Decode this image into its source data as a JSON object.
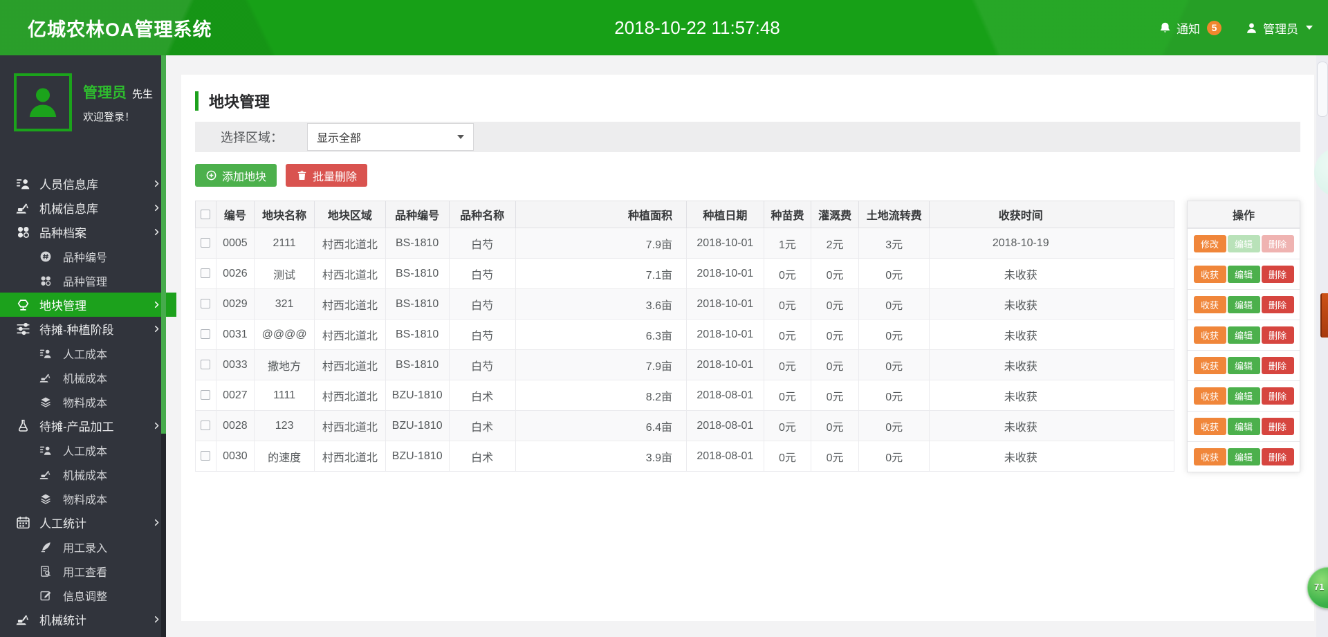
{
  "colors": {
    "brand_green": "#17a017",
    "accent_green": "#4cb04c",
    "active_menu_green": "#1ca11c",
    "danger_red": "#d9534f",
    "action_orange": "#f0863a",
    "badge_orange": "#f0872e",
    "sidebar_bg": "#31343c"
  },
  "header": {
    "app_title": "亿城农林OA管理系统",
    "datetime": "2018-10-22 11:57:48",
    "notifications": {
      "label": "通知",
      "count": "5"
    },
    "user_menu": {
      "label": "管理员"
    }
  },
  "sidebar": {
    "user": {
      "name": "管理员",
      "honorific": "先生",
      "welcome": "欢迎登录！"
    },
    "menu": [
      {
        "id": "personnel-info",
        "icon": "person",
        "label": "人员信息库",
        "arrow": true
      },
      {
        "id": "machinery-info",
        "icon": "crane",
        "label": "机械信息库",
        "arrow": true
      },
      {
        "id": "variety-archive",
        "icon": "clover",
        "label": "品种档案",
        "arrow": true,
        "children": [
          {
            "id": "variety-code",
            "icon": "hash",
            "label": "品种编号"
          },
          {
            "id": "variety-manage",
            "icon": "clover",
            "label": "品种管理"
          }
        ]
      },
      {
        "id": "plot-management",
        "icon": "plot",
        "label": "地块管理",
        "arrow": true,
        "active": true
      },
      {
        "id": "pending-planting-stage",
        "icon": "sliders",
        "label": "待摊-种植阶段",
        "arrow": true,
        "children": [
          {
            "id": "planting-labor-cost",
            "icon": "person",
            "label": "人工成本"
          },
          {
            "id": "planting-machine-cost",
            "icon": "crane",
            "label": "机械成本"
          },
          {
            "id": "planting-material-cost",
            "icon": "layers",
            "label": "物料成本"
          }
        ]
      },
      {
        "id": "pending-product-processing",
        "icon": "flask",
        "label": "待摊-产品加工",
        "arrow": true,
        "children": [
          {
            "id": "processing-labor-cost",
            "icon": "person",
            "label": "人工成本"
          },
          {
            "id": "processing-machine-cost",
            "icon": "crane",
            "label": "机械成本"
          },
          {
            "id": "processing-material-cost",
            "icon": "layers",
            "label": "物料成本"
          }
        ]
      },
      {
        "id": "labor-statistics",
        "icon": "calendar",
        "label": "人工统计",
        "arrow": true,
        "children": [
          {
            "id": "labor-entry",
            "icon": "pen",
            "label": "用工录入"
          },
          {
            "id": "labor-view",
            "icon": "doc-search",
            "label": "用工查看"
          },
          {
            "id": "info-adjust",
            "icon": "edit-square",
            "label": "信息调整"
          }
        ]
      },
      {
        "id": "machinery-statistics",
        "icon": "crane",
        "label": "机械统计",
        "arrow": true
      }
    ]
  },
  "main": {
    "page_title": "地块管理",
    "filter": {
      "label": "选择区域：",
      "selected_option": "显示全部"
    },
    "toolbar": {
      "add_plot": "添加地块",
      "batch_delete": "批量删除"
    },
    "table": {
      "action_header": "操作",
      "col_ids": [
        "id",
        "plot-name",
        "plot-region",
        "variety-code",
        "variety-name",
        "planting-area",
        "planting-date",
        "seedling-fee",
        "irrigation-fee",
        "land-transfer-fee",
        "harvest-time"
      ],
      "headers": [
        "编号",
        "地块名称",
        "地块区域",
        "品种编号",
        "品种名称",
        "种植面积",
        "种植日期",
        "种苗费",
        "灌溉费",
        "土地流转费",
        "收获时间"
      ],
      "rows": [
        {
          "cells": [
            "0005",
            "2111",
            "村西北道北",
            "BS-1810",
            "白芍",
            "7.9亩",
            "2018-10-01",
            "1元",
            "2元",
            "3元",
            "2018-10-19"
          ],
          "actions": [
            {
              "name": "modify-button",
              "label": "修改",
              "style": "orange",
              "disabled": false
            },
            {
              "name": "edit-button",
              "label": "编辑",
              "style": "green",
              "disabled": true
            },
            {
              "name": "delete-button",
              "label": "删除",
              "style": "red",
              "disabled": true
            }
          ]
        },
        {
          "cells": [
            "0026",
            "测试",
            "村西北道北",
            "BS-1810",
            "白芍",
            "7.1亩",
            "2018-10-01",
            "0元",
            "0元",
            "0元",
            "未收获"
          ],
          "actions": [
            {
              "name": "harvest-button",
              "label": "收获",
              "style": "orange",
              "disabled": false
            },
            {
              "name": "edit-button",
              "label": "编辑",
              "style": "green",
              "disabled": false
            },
            {
              "name": "delete-button",
              "label": "删除",
              "style": "red",
              "disabled": false
            }
          ]
        },
        {
          "cells": [
            "0029",
            "321",
            "村西北道北",
            "BS-1810",
            "白芍",
            "3.6亩",
            "2018-10-01",
            "0元",
            "0元",
            "0元",
            "未收获"
          ],
          "actions": [
            {
              "name": "harvest-button",
              "label": "收获",
              "style": "orange",
              "disabled": false
            },
            {
              "name": "edit-button",
              "label": "编辑",
              "style": "green",
              "disabled": false
            },
            {
              "name": "delete-button",
              "label": "删除",
              "style": "red",
              "disabled": false
            }
          ]
        },
        {
          "cells": [
            "0031",
            "@@@@",
            "村西北道北",
            "BS-1810",
            "白芍",
            "6.3亩",
            "2018-10-01",
            "0元",
            "0元",
            "0元",
            "未收获"
          ],
          "actions": [
            {
              "name": "harvest-button",
              "label": "收获",
              "style": "orange",
              "disabled": false
            },
            {
              "name": "edit-button",
              "label": "编辑",
              "style": "green",
              "disabled": false
            },
            {
              "name": "delete-button",
              "label": "删除",
              "style": "red",
              "disabled": false
            }
          ]
        },
        {
          "cells": [
            "0033",
            "撒地方",
            "村西北道北",
            "BS-1810",
            "白芍",
            "7.9亩",
            "2018-10-01",
            "0元",
            "0元",
            "0元",
            "未收获"
          ],
          "actions": [
            {
              "name": "harvest-button",
              "label": "收获",
              "style": "orange",
              "disabled": false
            },
            {
              "name": "edit-button",
              "label": "编辑",
              "style": "green",
              "disabled": false
            },
            {
              "name": "delete-button",
              "label": "删除",
              "style": "red",
              "disabled": false
            }
          ]
        },
        {
          "cells": [
            "0027",
            "1111",
            "村西北道北",
            "BZU-1810",
            "白术",
            "8.2亩",
            "2018-08-01",
            "0元",
            "0元",
            "0元",
            "未收获"
          ],
          "actions": [
            {
              "name": "harvest-button",
              "label": "收获",
              "style": "orange",
              "disabled": false
            },
            {
              "name": "edit-button",
              "label": "编辑",
              "style": "green",
              "disabled": false
            },
            {
              "name": "delete-button",
              "label": "删除",
              "style": "red",
              "disabled": false
            }
          ]
        },
        {
          "cells": [
            "0028",
            "123",
            "村西北道北",
            "BZU-1810",
            "白术",
            "6.4亩",
            "2018-08-01",
            "0元",
            "0元",
            "0元",
            "未收获"
          ],
          "actions": [
            {
              "name": "harvest-button",
              "label": "收获",
              "style": "orange",
              "disabled": false
            },
            {
              "name": "edit-button",
              "label": "编辑",
              "style": "green",
              "disabled": false
            },
            {
              "name": "delete-button",
              "label": "删除",
              "style": "red",
              "disabled": false
            }
          ]
        },
        {
          "cells": [
            "0030",
            "的速度",
            "村西北道北",
            "BZU-1810",
            "白术",
            "3.9亩",
            "2018-08-01",
            "0元",
            "0元",
            "0元",
            "未收获"
          ],
          "actions": [
            {
              "name": "harvest-button",
              "label": "收获",
              "style": "orange",
              "disabled": false
            },
            {
              "name": "edit-button",
              "label": "编辑",
              "style": "green",
              "disabled": false
            },
            {
              "name": "delete-button",
              "label": "删除",
              "style": "red",
              "disabled": false
            }
          ]
        }
      ]
    }
  },
  "floating": {
    "badge_text": "71"
  }
}
